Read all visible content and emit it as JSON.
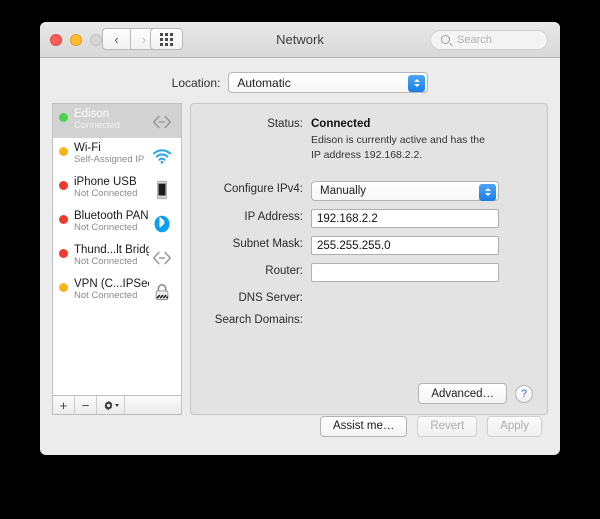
{
  "window": {
    "title": "Network",
    "traffic_lights": [
      "close",
      "minimize",
      "zoom-disabled"
    ],
    "nav_back": "‹",
    "nav_forward": "›",
    "grid_icon": "show-all-icon",
    "search_placeholder": "Search"
  },
  "location": {
    "label": "Location:",
    "value": "Automatic"
  },
  "services": [
    {
      "name": "Edison",
      "status": "Connected",
      "dot": "green",
      "icon": "thunderbolt-icon",
      "selected": true
    },
    {
      "name": "Wi-Fi",
      "status": "Self-Assigned IP",
      "dot": "amber",
      "icon": "wifi-icon",
      "selected": false
    },
    {
      "name": "iPhone USB",
      "status": "Not Connected",
      "dot": "red",
      "icon": "iphone-icon",
      "selected": false
    },
    {
      "name": "Bluetooth PAN",
      "status": "Not Connected",
      "dot": "red",
      "icon": "bluetooth-icon",
      "selected": false
    },
    {
      "name": "Thund...lt Bridge",
      "status": "Not Connected",
      "dot": "red",
      "icon": "thunderbolt-icon",
      "selected": false
    },
    {
      "name": "VPN (C...IPSec)",
      "status": "Not Connected",
      "dot": "amber",
      "icon": "vpn-lock-icon",
      "selected": false
    }
  ],
  "list_toolbar": {
    "add": "+",
    "remove": "−",
    "actions": "gear-icon"
  },
  "detail": {
    "status_label": "Status:",
    "status_value": "Connected",
    "status_description": "Edison is currently active and has the IP address 192.168.2.2.",
    "configure_label": "Configure IPv4:",
    "configure_value": "Manually",
    "ip_label": "IP Address:",
    "ip_value": "192.168.2.2",
    "subnet_label": "Subnet Mask:",
    "subnet_value": "255.255.255.0",
    "router_label": "Router:",
    "router_value": "",
    "dns_label": "DNS Server:",
    "dns_value": "",
    "search_domains_label": "Search Domains:",
    "search_domains_value": "",
    "advanced_button": "Advanced…",
    "help_button": "?"
  },
  "footer": {
    "assist": "Assist me…",
    "revert": "Revert",
    "apply": "Apply"
  },
  "colors": {
    "accent_blue": "#1a7ee8",
    "status_green": "#4cd24c",
    "status_amber": "#f5b417",
    "status_red": "#f0392c",
    "selection_grey": "#d2d2d2"
  }
}
